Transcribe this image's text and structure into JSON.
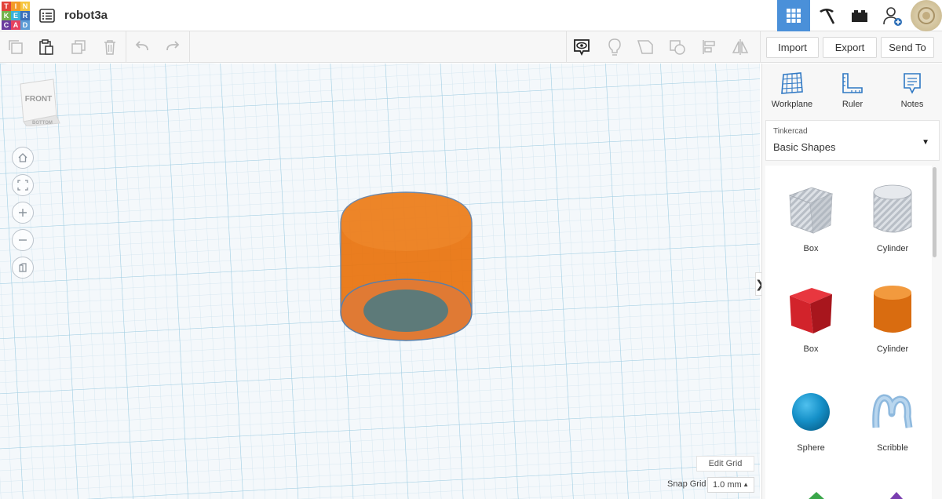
{
  "app": {
    "logo_letters": [
      "T",
      "I",
      "N",
      "K",
      "E",
      "R",
      "C",
      "A",
      "D"
    ],
    "logo_colors": [
      "#e2423a",
      "#f39a27",
      "#f6c640",
      "#73b24a",
      "#3ab1d8",
      "#3d6fb8",
      "#6a3c9e",
      "#e5415f",
      "#5c9bd5"
    ],
    "project_title": "robot3a"
  },
  "topbar": {
    "icons": [
      "3d-design-grid-icon",
      "pickaxe-icon",
      "bricks-icon",
      "add-user-icon"
    ],
    "active_color": "#4a90d9"
  },
  "toolbar": {
    "left_icons": [
      "copy-icon",
      "paste-icon",
      "duplicate-icon",
      "delete-icon",
      "undo-icon",
      "redo-icon"
    ],
    "right_icons": [
      "notes-visibility-icon",
      "lightbulb-icon",
      "group-icon",
      "ungroup-icon",
      "align-icon",
      "mirror-icon"
    ],
    "import_label": "Import",
    "export_label": "Export",
    "send_to_label": "Send To"
  },
  "workplane": {
    "viewcube_front": "FRONT",
    "viewcube_bottom": "BOTTOM",
    "nav": [
      "home-view-icon",
      "fit-view-icon",
      "zoom-in-icon",
      "zoom-out-icon",
      "ortho-view-icon"
    ],
    "edit_grid_label": "Edit Grid",
    "snap_grid_label": "Snap Grid",
    "snap_grid_value": "1.0 mm",
    "collapse_glyph": "❯",
    "object_color": "#e8720c"
  },
  "panel": {
    "tools": [
      {
        "label": "Workplane",
        "icon": "workplane-icon"
      },
      {
        "label": "Ruler",
        "icon": "ruler-icon"
      },
      {
        "label": "Notes",
        "icon": "notes-icon"
      }
    ],
    "library_small": "Tinkercad",
    "library_name": "Basic Shapes",
    "shapes": [
      {
        "label": "Box",
        "icon": "box-hole-icon"
      },
      {
        "label": "Cylinder",
        "icon": "cylinder-hole-icon"
      },
      {
        "label": "Box",
        "icon": "box-solid-icon"
      },
      {
        "label": "Cylinder",
        "icon": "cylinder-solid-icon"
      },
      {
        "label": "Sphere",
        "icon": "sphere-icon"
      },
      {
        "label": "Scribble",
        "icon": "scribble-icon"
      }
    ]
  }
}
